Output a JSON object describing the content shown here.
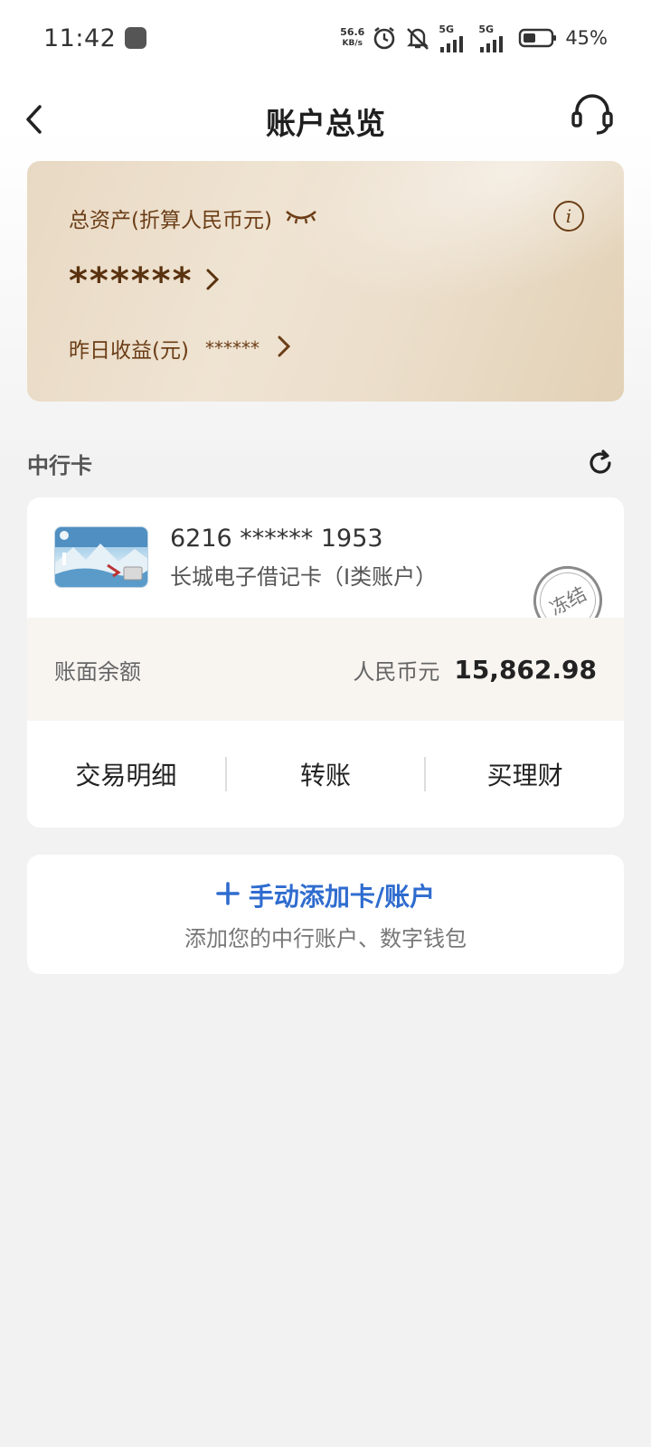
{
  "status_bar": {
    "time": "11:42",
    "net_speed_value": "56.6",
    "net_speed_unit": "KB/s",
    "signal_1_label": "5G",
    "signal_2_label": "5G",
    "battery_percent": "45%",
    "icons": [
      "app-icon",
      "alarm-icon",
      "mute-icon",
      "signal-icon",
      "signal-icon",
      "battery-icon"
    ]
  },
  "header": {
    "title": "账户总览",
    "back_icon": "chevron-left-icon",
    "service_icon": "headset-icon"
  },
  "assets": {
    "label": "总资产(折算人民币元)",
    "value": "******",
    "yesterday_label": "昨日收益(元)",
    "yesterday_value": "******",
    "info_glyph": "i"
  },
  "section": {
    "title": "中行卡"
  },
  "account": {
    "card_number": "6216 ****** 1953",
    "card_type": "长城电子借记卡（I类账户）",
    "status_stamp": "冻结",
    "balance_label": "账面余额",
    "currency": "人民币元",
    "balance": "15,862.98",
    "actions": [
      "交易明细",
      "转账",
      "买理财"
    ]
  },
  "add_account": {
    "title": "手动添加卡/账户",
    "subtitle": "添加您的中行账户、数字钱包"
  },
  "colors": {
    "accent_blue": "#2f6ccf",
    "gold_text": "#6b3d16",
    "background": "#f2f2f2"
  }
}
